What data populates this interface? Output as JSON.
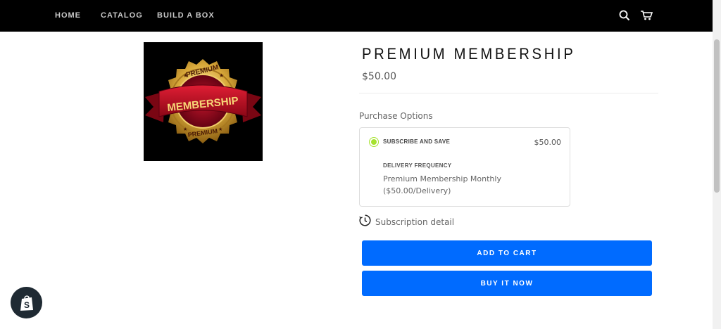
{
  "nav": {
    "items": [
      {
        "label": "HOME"
      },
      {
        "label": "CATALOG"
      },
      {
        "label": "BUILD A BOX"
      }
    ],
    "icons": [
      "search-icon",
      "cart-icon"
    ]
  },
  "product": {
    "image_text": {
      "top": "PREMIUM",
      "center": "MEMBERSHIP",
      "bottom": "PREMIUM"
    },
    "title": "PREMIUM MEMBERSHIP",
    "price": "$50.00"
  },
  "purchase": {
    "label": "Purchase Options",
    "option": {
      "title": "SUBSCRIBE AND SAVE",
      "price": "$50.00",
      "selected": true,
      "frequency_label": "DELIVERY FREQUENCY",
      "frequency_line1": "Premium Membership Monthly",
      "frequency_line2": "($50.00/Delivery)"
    },
    "subscription_detail": "Subscription detail"
  },
  "buttons": {
    "add_to_cart": "ADD TO CART",
    "buy_now": "BUY IT NOW"
  },
  "colors": {
    "topbar": "#000000",
    "button": "#006bff",
    "radio": "#a6e22e",
    "badge": "#1f2a33"
  }
}
